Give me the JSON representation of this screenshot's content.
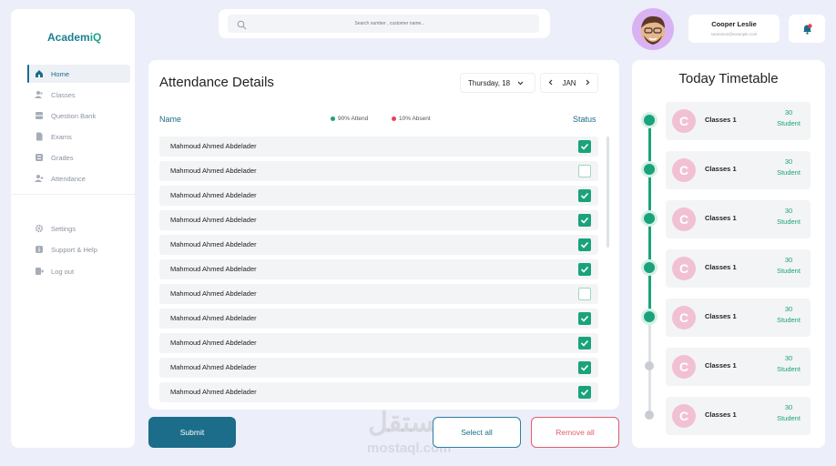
{
  "app": {
    "logo_main": "Academ",
    "logo_accent": "iQ"
  },
  "sidebar": {
    "items": [
      {
        "label": "Home",
        "icon": "home-icon",
        "active": true
      },
      {
        "label": "Classes",
        "icon": "users-icon"
      },
      {
        "label": "Question Bank",
        "icon": "database-icon"
      },
      {
        "label": "Exams",
        "icon": "document-icon"
      },
      {
        "label": "Grades",
        "icon": "grades-icon"
      },
      {
        "label": "Attendance",
        "icon": "user-plus-icon"
      }
    ],
    "bottom_items": [
      {
        "label": "Settings",
        "icon": "gear-icon"
      },
      {
        "label": "Support & Help",
        "icon": "info-icon"
      },
      {
        "label": "Log out",
        "icon": "logout-icon"
      }
    ]
  },
  "search": {
    "placeholder": "Search number , customer name..."
  },
  "user": {
    "name": "Cooper Leslie",
    "email": "sarasmus@example.com"
  },
  "attendance": {
    "title": "Attendance Details",
    "date": "Thursday, 18",
    "month": "JAN",
    "col_name": "Name",
    "col_status": "Status",
    "attend_legend": "90% Attend",
    "absent_legend": "10% Absent",
    "rows": [
      {
        "name": "Mahmoud Ahmed Abdelader",
        "present": true
      },
      {
        "name": "Mahmoud Ahmed Abdelader",
        "present": false
      },
      {
        "name": "Mahmoud Ahmed Abdelader",
        "present": true
      },
      {
        "name": "Mahmoud Ahmed Abdelader",
        "present": true
      },
      {
        "name": "Mahmoud Ahmed Abdelader",
        "present": true
      },
      {
        "name": "Mahmoud Ahmed Abdelader",
        "present": true
      },
      {
        "name": "Mahmoud Ahmed Abdelader",
        "present": false
      },
      {
        "name": "Mahmoud Ahmed Abdelader",
        "present": true
      },
      {
        "name": "Mahmoud Ahmed Abdelader",
        "present": true
      },
      {
        "name": "Mahmoud Ahmed Abdelader",
        "present": true
      },
      {
        "name": "Mahmoud Ahmed Abdelader",
        "present": true
      }
    ]
  },
  "buttons": {
    "submit": "Submit",
    "select_all": "Select all",
    "remove_all": "Remove all"
  },
  "watermark": {
    "arabic": "مستقل",
    "latin": "mostaql.com"
  },
  "timetable": {
    "title": "Today Timetable",
    "items": [
      {
        "initial": "C",
        "name": "Classes 1",
        "count": "30",
        "unit": "Student",
        "done": true
      },
      {
        "initial": "C",
        "name": "Classes 1",
        "count": "30",
        "unit": "Student",
        "done": true
      },
      {
        "initial": "C",
        "name": "Classes 1",
        "count": "30",
        "unit": "Student",
        "done": true
      },
      {
        "initial": "C",
        "name": "Classes 1",
        "count": "30",
        "unit": "Student",
        "done": true
      },
      {
        "initial": "C",
        "name": "Classes 1",
        "count": "30",
        "unit": "Student",
        "done": true
      },
      {
        "initial": "C",
        "name": "Classes 1",
        "count": "30",
        "unit": "Student",
        "done": false
      },
      {
        "initial": "C",
        "name": "Classes 1",
        "count": "30",
        "unit": "Student",
        "done": false
      }
    ]
  },
  "colors": {
    "primary": "#1b6d8a",
    "accent": "#1aa37a",
    "danger": "#e35d6a",
    "notification": "#e8424f"
  }
}
